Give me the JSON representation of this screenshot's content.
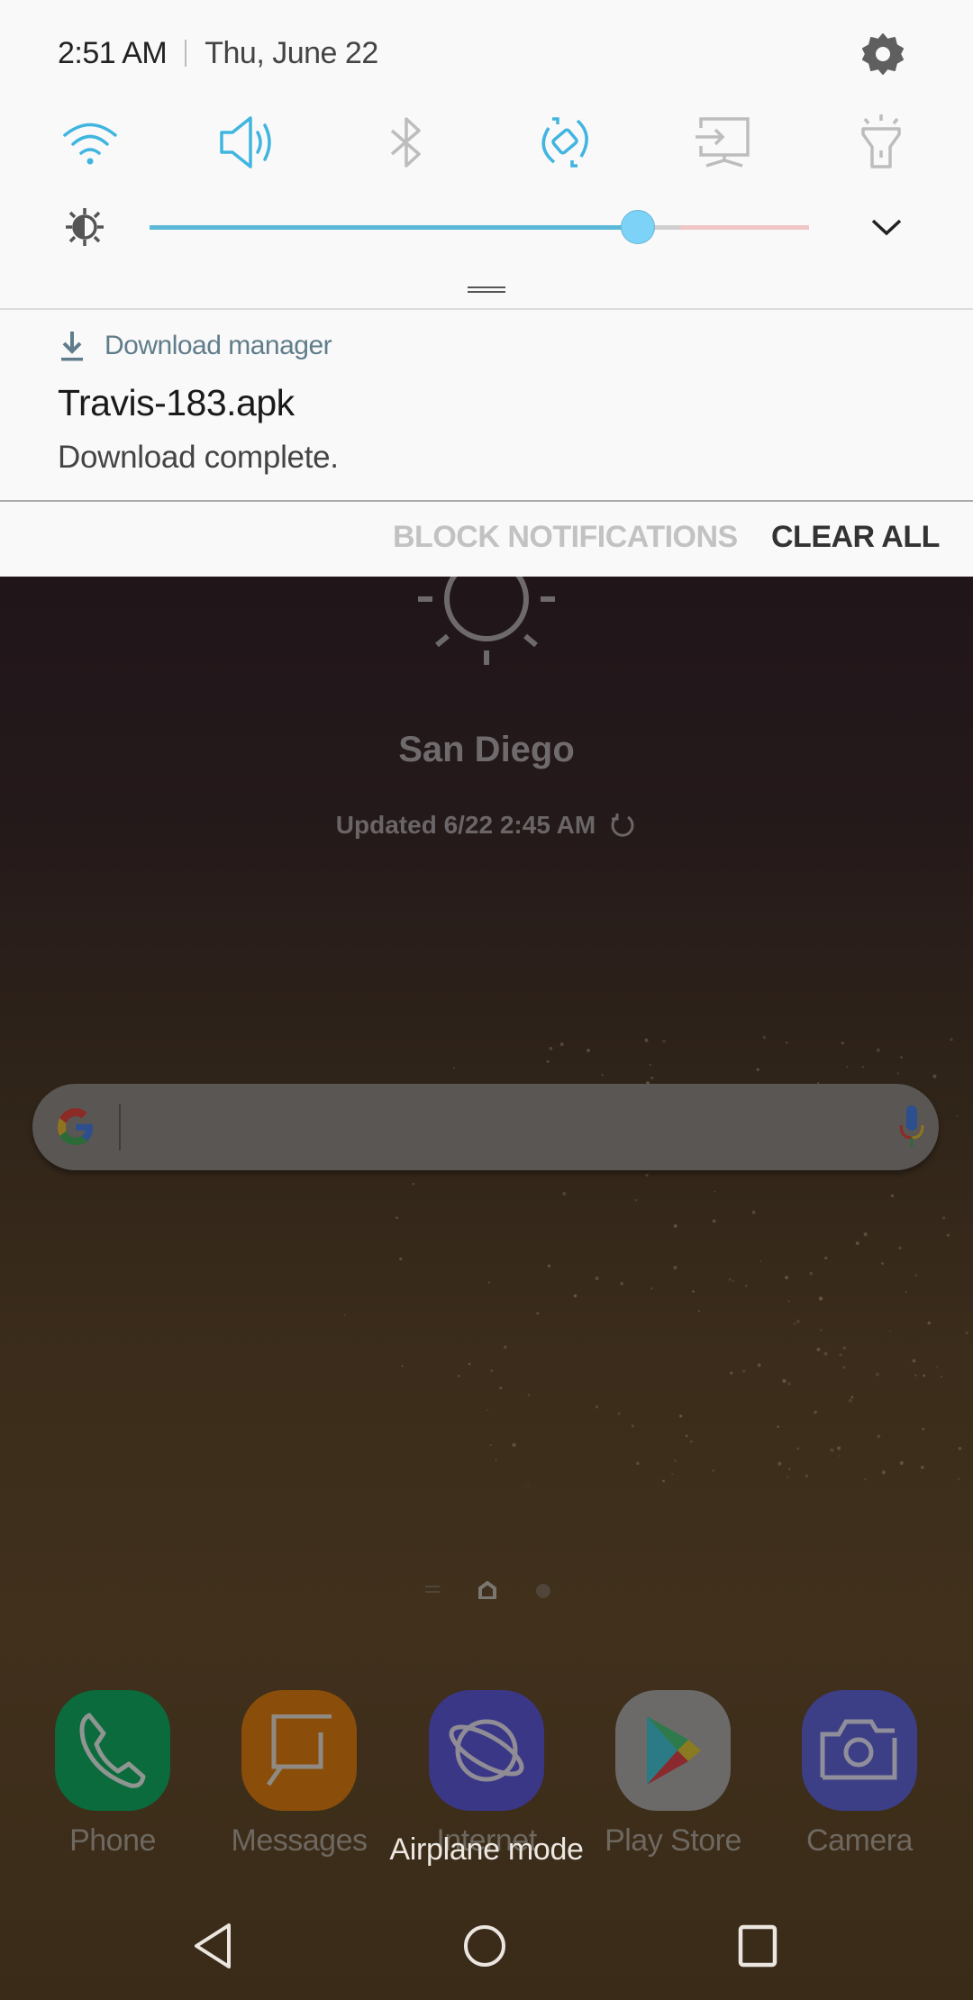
{
  "status": {
    "time": "2:51 AM",
    "date": "Thu, June 22"
  },
  "quick_settings": {
    "tiles": [
      {
        "name": "wifi",
        "icon": "wifi-icon",
        "state": "on"
      },
      {
        "name": "sound",
        "icon": "volume-icon",
        "state": "on"
      },
      {
        "name": "bluetooth",
        "icon": "bluetooth-icon",
        "state": "off"
      },
      {
        "name": "auto-rotate",
        "icon": "rotate-icon",
        "state": "on"
      },
      {
        "name": "screen-mirroring",
        "icon": "cast-screen-icon",
        "state": "off"
      },
      {
        "name": "flashlight",
        "icon": "flashlight-icon",
        "state": "off"
      }
    ],
    "brightness": {
      "value_fraction": 0.74
    },
    "active_color": "#3fb5e0",
    "inactive_color": "#bdbdbd"
  },
  "notification": {
    "app_name": "Download manager",
    "title": "Travis-183.apk",
    "text": "Download complete.",
    "app_color": "#607d8b"
  },
  "notification_actions": {
    "block_label": "BLOCK NOTIFICATIONS",
    "clear_label": "CLEAR ALL"
  },
  "weather": {
    "icon": "sun-icon",
    "city": "San Diego",
    "updated": "Updated 6/22 2:45 AM"
  },
  "search": {
    "placeholder": ""
  },
  "dock": {
    "apps": [
      {
        "label": "Phone",
        "color": "#0b6b3c"
      },
      {
        "label": "Messages",
        "color": "#8a4e0a"
      },
      {
        "label": "Internet",
        "color": "#3b3787"
      },
      {
        "label": "Play Store",
        "color": "#6b6a69"
      },
      {
        "label": "Camera",
        "color": "#3c3f86"
      }
    ]
  },
  "toast": "Airplane mode"
}
